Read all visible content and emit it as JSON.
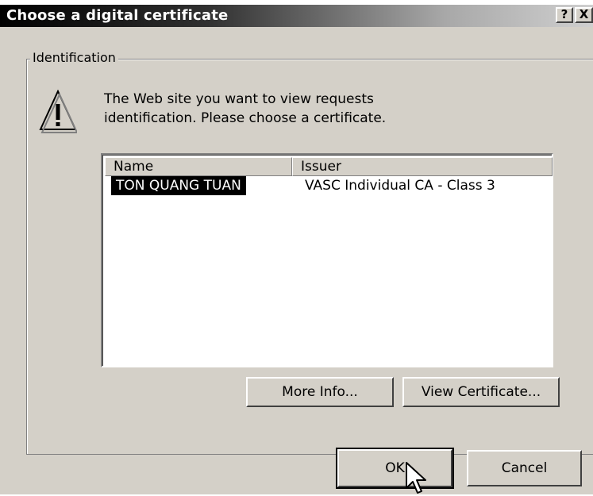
{
  "dialog": {
    "title": "Choose a digital certificate",
    "help_button": "?",
    "close_button": "X"
  },
  "group": {
    "label": "Identification",
    "message_line1": "The Web site you want to view requests",
    "message_line2": "identification. Please choose a certificate."
  },
  "list": {
    "columns": [
      "Name",
      "Issuer"
    ],
    "rows": [
      {
        "name": "TON QUANG TUAN",
        "issuer": "VASC Individual CA - Class 3",
        "selected": true
      }
    ]
  },
  "buttons": {
    "more_info": "More Info...",
    "view_certificate": "View Certificate...",
    "ok": "OK",
    "cancel": "Cancel"
  },
  "icons": {
    "warning": "warning-icon",
    "cursor": "mouse-pointer-icon"
  },
  "colors": {
    "dialog_bg": "#d4d0c8",
    "selection_bg": "#000000",
    "selection_fg": "#ffffff"
  }
}
